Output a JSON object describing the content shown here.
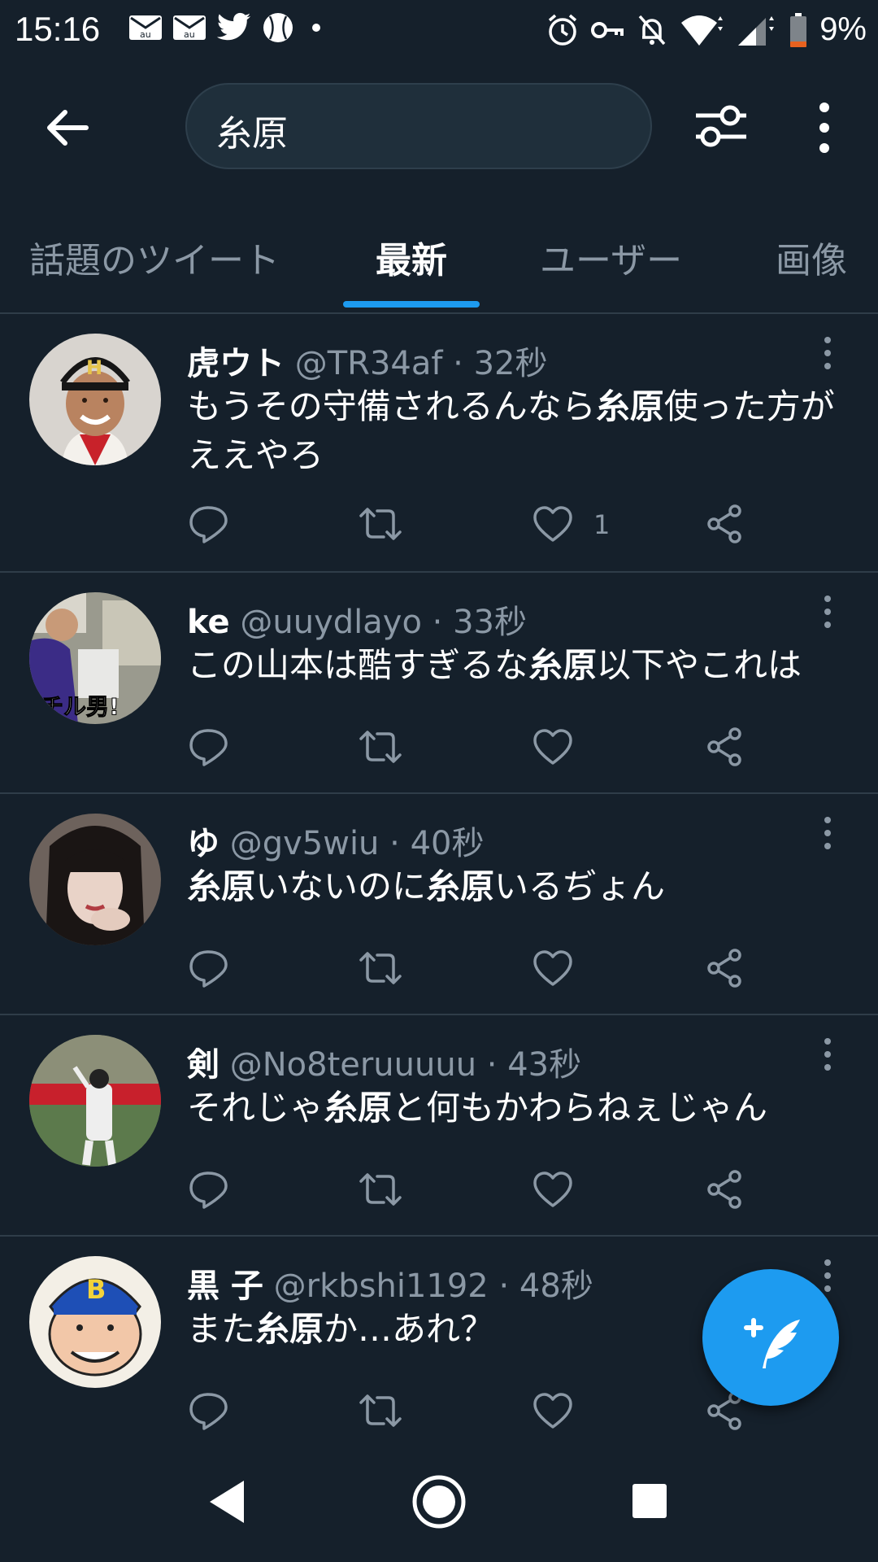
{
  "status_bar": {
    "time": "15:16",
    "battery": "9%",
    "left_icons": [
      "mail-au-icon",
      "mail-au-icon",
      "twitter-icon",
      "baseball-icon",
      "dot-icon"
    ],
    "right_icons": [
      "alarm-icon",
      "vpn-key-icon",
      "notifications-off-icon",
      "wifi-icon",
      "signal-icon",
      "battery-icon"
    ]
  },
  "search": {
    "query": "糸原"
  },
  "tabs": [
    {
      "label": "話題のツイート",
      "active": false
    },
    {
      "label": "最新",
      "active": true
    },
    {
      "label": "ユーザー",
      "active": false
    },
    {
      "label": "画像",
      "active": false
    }
  ],
  "tweets": [
    {
      "name": "虎ウト",
      "handle": "@TR34af",
      "sep": " · ",
      "time": "32秒",
      "text_parts": [
        {
          "t": "もうその守備されるんなら",
          "b": false
        },
        {
          "t": "糸原",
          "b": true
        },
        {
          "t": "使った方がええやろ",
          "b": false
        }
      ],
      "likes": "1"
    },
    {
      "name": "ke",
      "handle": "@uuydlayo",
      "sep": " · ",
      "time": "33秒",
      "text_parts": [
        {
          "t": "この山本は酷すぎるな",
          "b": false
        },
        {
          "t": "糸原",
          "b": true
        },
        {
          "t": "以下やこれは",
          "b": false
        }
      ],
      "likes": ""
    },
    {
      "name": "ゆ",
      "handle": "@gv5wiu",
      "sep": " · ",
      "time": "40秒",
      "text_parts": [
        {
          "t": "糸原",
          "b": true
        },
        {
          "t": "いないのに",
          "b": false
        },
        {
          "t": "糸原",
          "b": true
        },
        {
          "t": "いるぢょん",
          "b": false
        }
      ],
      "likes": ""
    },
    {
      "name": "剣",
      "handle": "@No8teruuuuu",
      "sep": " · ",
      "time": "43秒",
      "text_parts": [
        {
          "t": "それじゃ",
          "b": false
        },
        {
          "t": "糸原",
          "b": true
        },
        {
          "t": "と何もかわらねぇじゃん",
          "b": false
        }
      ],
      "likes": ""
    },
    {
      "name": "黒 子",
      "handle": "@rkbshi1192",
      "sep": " · ",
      "time": "48秒",
      "text_parts": [
        {
          "t": "また",
          "b": false
        },
        {
          "t": "糸原",
          "b": true
        },
        {
          "t": "か…あれ？",
          "b": false
        }
      ],
      "likes": ""
    }
  ],
  "colors": {
    "background": "#15202b",
    "accent": "#1d9bf0",
    "secondary_text": "#8b98a5",
    "divider": "#2f3d49"
  }
}
